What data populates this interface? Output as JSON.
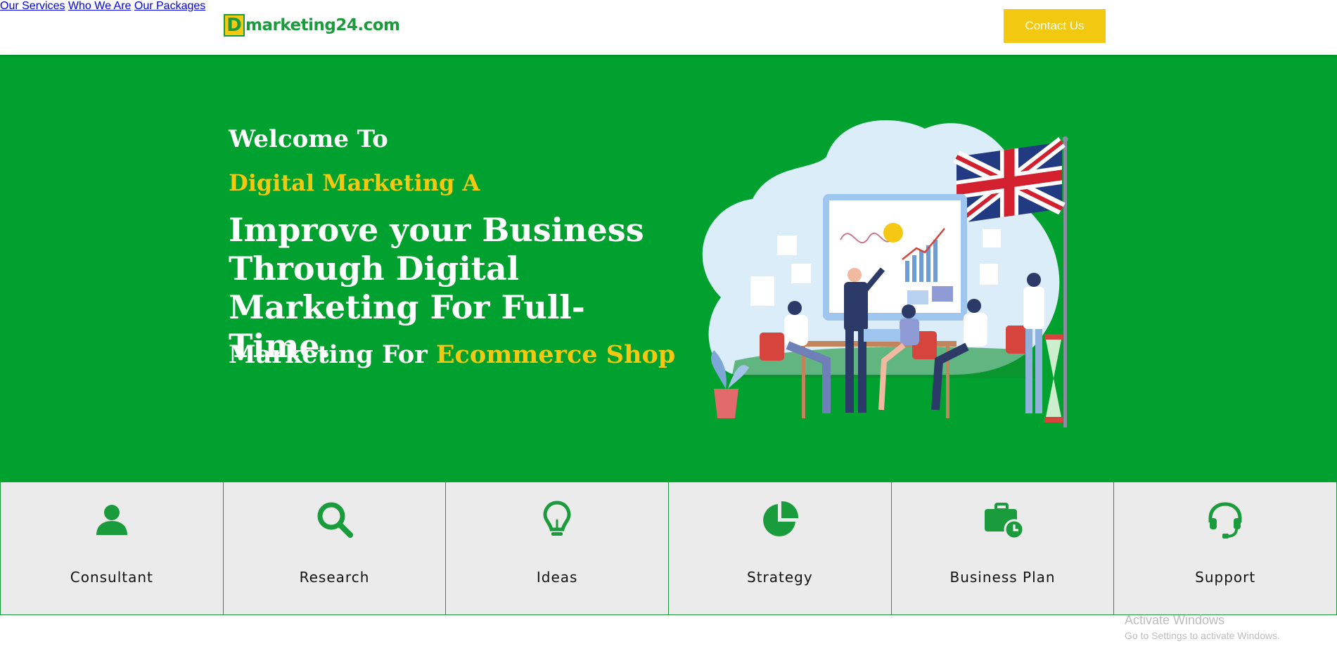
{
  "header": {
    "logo_letter": "D",
    "logo_text": "marketing24.com",
    "nav": [
      {
        "label": "Our Services"
      },
      {
        "label": "Who We Are"
      },
      {
        "label": "Our Packages"
      }
    ],
    "contact_label": "Contact Us"
  },
  "hero": {
    "welcome": "Welcome To",
    "digital": "Digital Marketing A",
    "headline": "Improve your Business Through Digital Marketing For Full-Time.",
    "sub_prefix": "Marketing For ",
    "sub_highlight": "Ecommerce Shop"
  },
  "features": [
    {
      "label": "Consultant",
      "icon": "user-icon"
    },
    {
      "label": "Research",
      "icon": "search-icon"
    },
    {
      "label": "Ideas",
      "icon": "lightbulb-icon"
    },
    {
      "label": "Strategy",
      "icon": "pie-chart-icon"
    },
    {
      "label": "Business Plan",
      "icon": "briefcase-clock-icon"
    },
    {
      "label": "Support",
      "icon": "headset-icon"
    }
  ],
  "watermark": {
    "title": "Activate Windows",
    "subtitle": "Go to Settings to activate Windows."
  },
  "colors": {
    "brand_green": "#00a12e",
    "accent_yellow": "#f2c811",
    "feature_bg": "#ebebeb"
  }
}
